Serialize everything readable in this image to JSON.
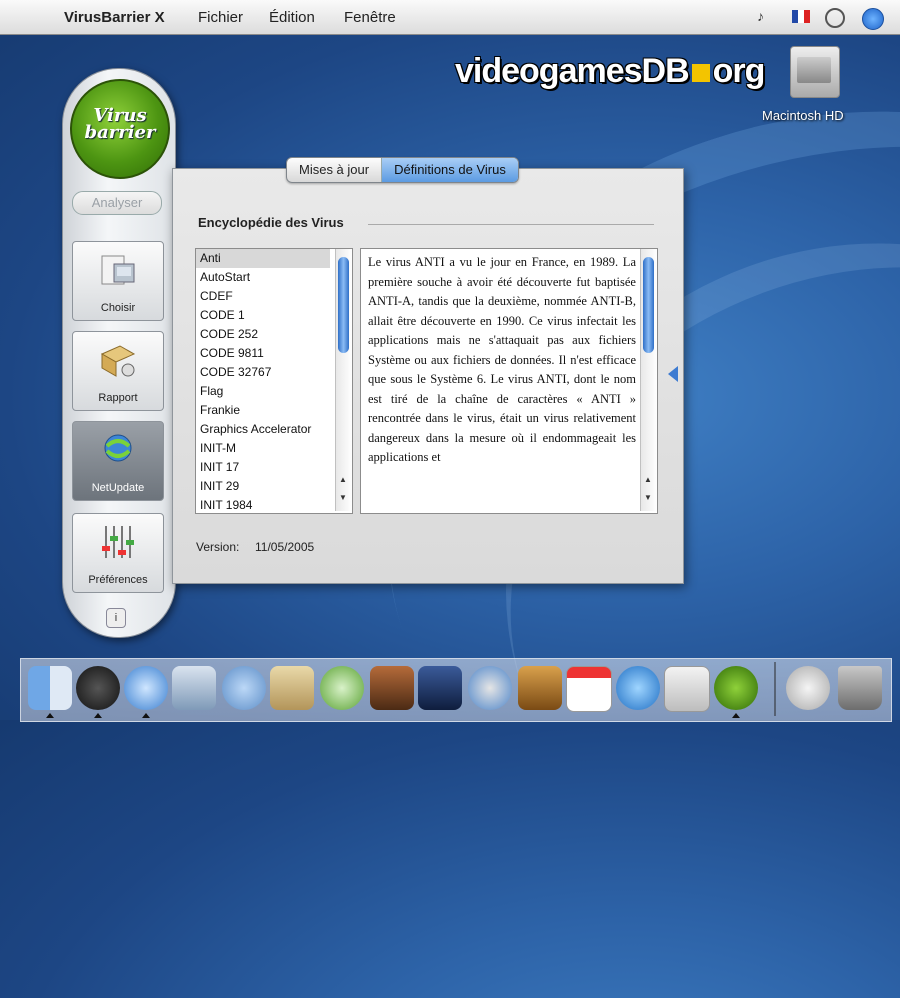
{
  "menubar": {
    "app_name": "VirusBarrier X",
    "items": [
      "Fichier",
      "Édition",
      "Fenêtre"
    ],
    "volume_icon": "♪"
  },
  "watermark": {
    "part1": "videogamesDB",
    "part2": "org"
  },
  "desktop": {
    "hd_label": "Macintosh HD"
  },
  "sidebar": {
    "logo_line1": "Virus",
    "logo_line2": "barrier",
    "analyse_label": "Analyser",
    "buttons": [
      {
        "label": "Choisir",
        "icon": "choose-files-icon"
      },
      {
        "label": "Rapport",
        "icon": "report-icon"
      },
      {
        "label": "NetUpdate",
        "icon": "netupdate-icon",
        "active": true
      },
      {
        "label": "Préférences",
        "icon": "preferences-icon"
      }
    ],
    "info_label": "i"
  },
  "tabs": [
    {
      "label": "Mises à jour",
      "selected": false
    },
    {
      "label": "Définitions de Virus",
      "selected": true
    }
  ],
  "section_title": "Encyclopédie des Virus",
  "virus_list": [
    "Anti",
    "AutoStart",
    "CDEF",
    "CODE 1",
    "CODE 252",
    "CODE 9811",
    "CODE 32767",
    "Flag",
    "Frankie",
    "Graphics Accelerator",
    "INIT-M",
    "INIT 17",
    "INIT 29",
    "INIT 1984"
  ],
  "selected_virus": "Anti",
  "description": "Le virus ANTI a vu le jour en France, en 1989. La première souche à avoir été découverte fut baptisée ANTI-A, tandis que la deuxième, nommée ANTI-B, allait être découverte en 1990. Ce virus infectait les applications mais ne s'attaquait pas aux fichiers Système ou aux fichiers de données. Il n'est efficace que sous le Système 6. Le virus ANTI, dont le nom est tiré de la chaîne de caractères « ANTI » rencontrée dans le virus, était un virus relativement dangereux dans la mesure où il endommageait les applications et",
  "version": {
    "label": "Version:",
    "value": "11/05/2005"
  },
  "dock": {
    "icons": [
      "finder-icon",
      "dashboard-icon",
      "safari-icon",
      "preview-icon",
      "ichat-icon",
      "addressbook-icon",
      "itunes-icon",
      "iphoto-icon",
      "imovie-icon",
      "idvd-icon",
      "garageband-icon",
      "ical-icon",
      "sync-icon",
      "apple-icon",
      "virusbarrier-icon",
      "mail-icon",
      "trash-icon"
    ]
  },
  "colors": {
    "accent": "#5c9be2",
    "desktop": "#2d63a8",
    "logo_green": "#4d9512"
  }
}
